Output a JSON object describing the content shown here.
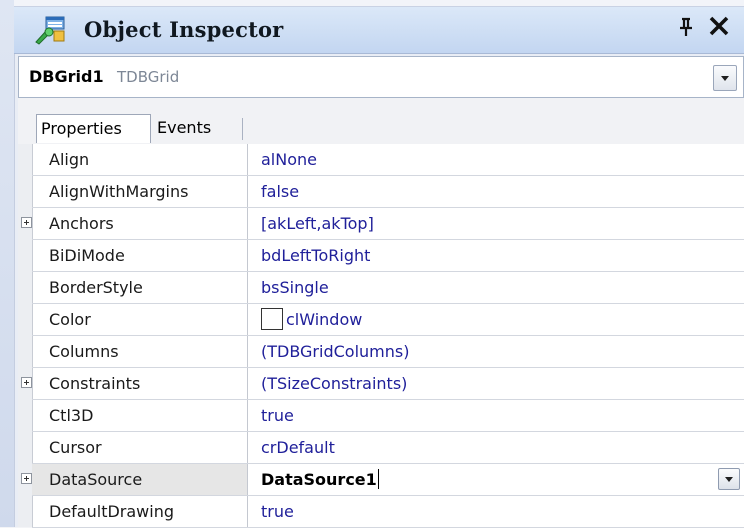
{
  "window": {
    "title": "Object Inspector",
    "pin_glyph": "ᴪ",
    "close_glyph": "✕",
    "icon": "object-inspector-icon"
  },
  "selector": {
    "component_name": "DBGrid1",
    "component_class": "TDBGrid"
  },
  "tabs": [
    {
      "label": "Properties",
      "active": true
    },
    {
      "label": "Events",
      "active": false
    }
  ],
  "properties": [
    {
      "name": "Align",
      "value": "alNone",
      "expandable": false
    },
    {
      "name": "AlignWithMargins",
      "value": "false",
      "expandable": false
    },
    {
      "name": "Anchors",
      "value": "[akLeft,akTop]",
      "expandable": true
    },
    {
      "name": "BiDiMode",
      "value": "bdLeftToRight",
      "expandable": false
    },
    {
      "name": "BorderStyle",
      "value": "bsSingle",
      "expandable": false
    },
    {
      "name": "Color",
      "value": "clWindow",
      "expandable": false,
      "swatch": "#ffffff"
    },
    {
      "name": "Columns",
      "value": "(TDBGridColumns)",
      "expandable": false
    },
    {
      "name": "Constraints",
      "value": "(TSizeConstraints)",
      "expandable": true
    },
    {
      "name": "Ctl3D",
      "value": "true",
      "expandable": false
    },
    {
      "name": "Cursor",
      "value": "crDefault",
      "expandable": false
    },
    {
      "name": "DataSource",
      "value": "DataSource1",
      "expandable": true,
      "selected": true
    },
    {
      "name": "DefaultDrawing",
      "value": "true",
      "expandable": false
    }
  ],
  "colors": {
    "value_text": "#20209a",
    "titlebar": "#c3d6f1"
  }
}
